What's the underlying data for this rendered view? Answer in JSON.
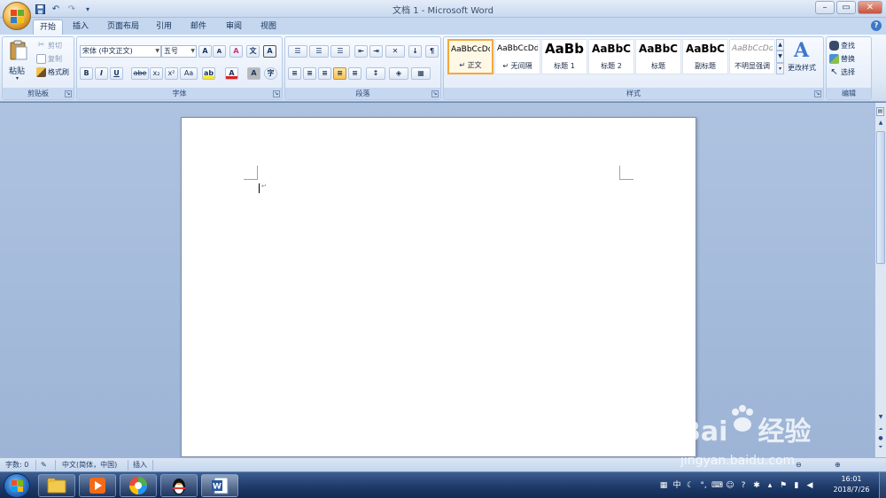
{
  "window": {
    "title": "文档 1 - Microsoft Word",
    "controls": {
      "minimize": "–",
      "maximize": "▭",
      "close": "✕"
    }
  },
  "quick_access": {
    "save": "💾",
    "undo": "↶",
    "redo": "↷",
    "customize": "▾"
  },
  "tabs": [
    "开始",
    "插入",
    "页面布局",
    "引用",
    "邮件",
    "审阅",
    "视图"
  ],
  "active_tab": "开始",
  "help": "?",
  "clipboard": {
    "label": "剪贴板",
    "paste": "粘贴",
    "paste_dropdown": "▾",
    "cut": "剪切",
    "copy": "复制",
    "format_painter": "格式刷"
  },
  "font": {
    "label": "字体",
    "font_name": "宋体 (中文正文)",
    "font_size": "五号",
    "grow": "A",
    "shrink": "A",
    "clear_format": "A",
    "phonetic": "文",
    "char_border": "A",
    "bold": "B",
    "italic": "I",
    "underline": "U",
    "strikethrough": "abe",
    "subscript": "x₂",
    "superscript": "x²",
    "change_case": "Aa",
    "highlight": "ab",
    "font_color": "A",
    "char_shading": "A",
    "enclose": "字"
  },
  "paragraph": {
    "label": "段落",
    "bullets": "☰",
    "numbering": "☰",
    "multilevel": "☰",
    "decrease_indent": "⇤",
    "increase_indent": "⇥",
    "cn_layout": "✕",
    "sort": "↓",
    "show_marks": "¶",
    "align_left": "≡",
    "center": "≡",
    "align_right": "≡",
    "justify": "≡",
    "distribute": "≡",
    "line_spacing": "↕",
    "shading": "◈",
    "borders": "▦"
  },
  "styles": {
    "label": "样式",
    "items": [
      {
        "sample": "AaBbCcDd",
        "name": "↵ 正文"
      },
      {
        "sample": "AaBbCcDd",
        "name": "↵ 无间隔"
      },
      {
        "sample": "AaBb",
        "name": "标题 1"
      },
      {
        "sample": "AaBbC",
        "name": "标题 2"
      },
      {
        "sample": "AaBbC",
        "name": "标题"
      },
      {
        "sample": "AaBbC",
        "name": "副标题"
      },
      {
        "sample": "AaBbCcDd",
        "name": "不明显强调"
      }
    ],
    "scroll_up": "▲",
    "scroll_down": "▼",
    "more": "▾",
    "change_styles": "更改样式",
    "change_styles_icon": "A"
  },
  "editing": {
    "label": "编辑",
    "find": "查找",
    "replace": "替换",
    "select": "选择"
  },
  "document": {
    "paragraph_mark": "↵"
  },
  "statusbar": {
    "word_count": "字数: 0",
    "language": "中文(简体，中国)",
    "insert_mode": "插入"
  },
  "taskbar": {
    "ime_lang": "中",
    "clock_time": "16:01",
    "clock_date": "2018/7/26"
  },
  "watermark": {
    "brand": "Bai",
    "brand2": "经验",
    "url": "jingyan.baidu.com"
  },
  "colors": {
    "accent": "#2b579a",
    "ribbon": "#dde8f6",
    "doc_bg": "#9db4d6",
    "active_style": "#f2a93b"
  }
}
